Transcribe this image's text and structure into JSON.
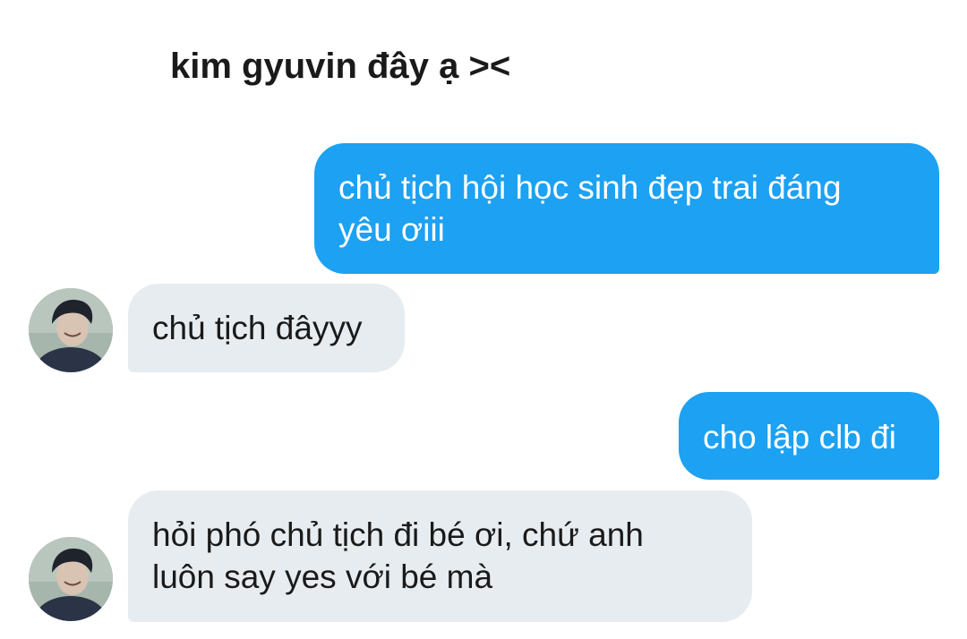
{
  "conversation": {
    "title": "kim gyuvin đây ạ ><"
  },
  "messages": [
    {
      "sender": "self",
      "text": "chủ tịch hội học sinh đẹp trai đáng\nyêu ơiii"
    },
    {
      "sender": "kim gyuvin",
      "text": "chủ tịch đâyyy"
    },
    {
      "sender": "self",
      "text": "cho lập clb đi"
    },
    {
      "sender": "kim gyuvin",
      "text": "hỏi phó chủ tịch đi bé ơi, chứ anh\nluôn say yes với bé mà"
    }
  ],
  "colors": {
    "sent_bubble": "#1da1f2",
    "received_bubble": "#e6ecf0",
    "sent_text": "#ffffff",
    "received_text": "#1a1a1a"
  }
}
